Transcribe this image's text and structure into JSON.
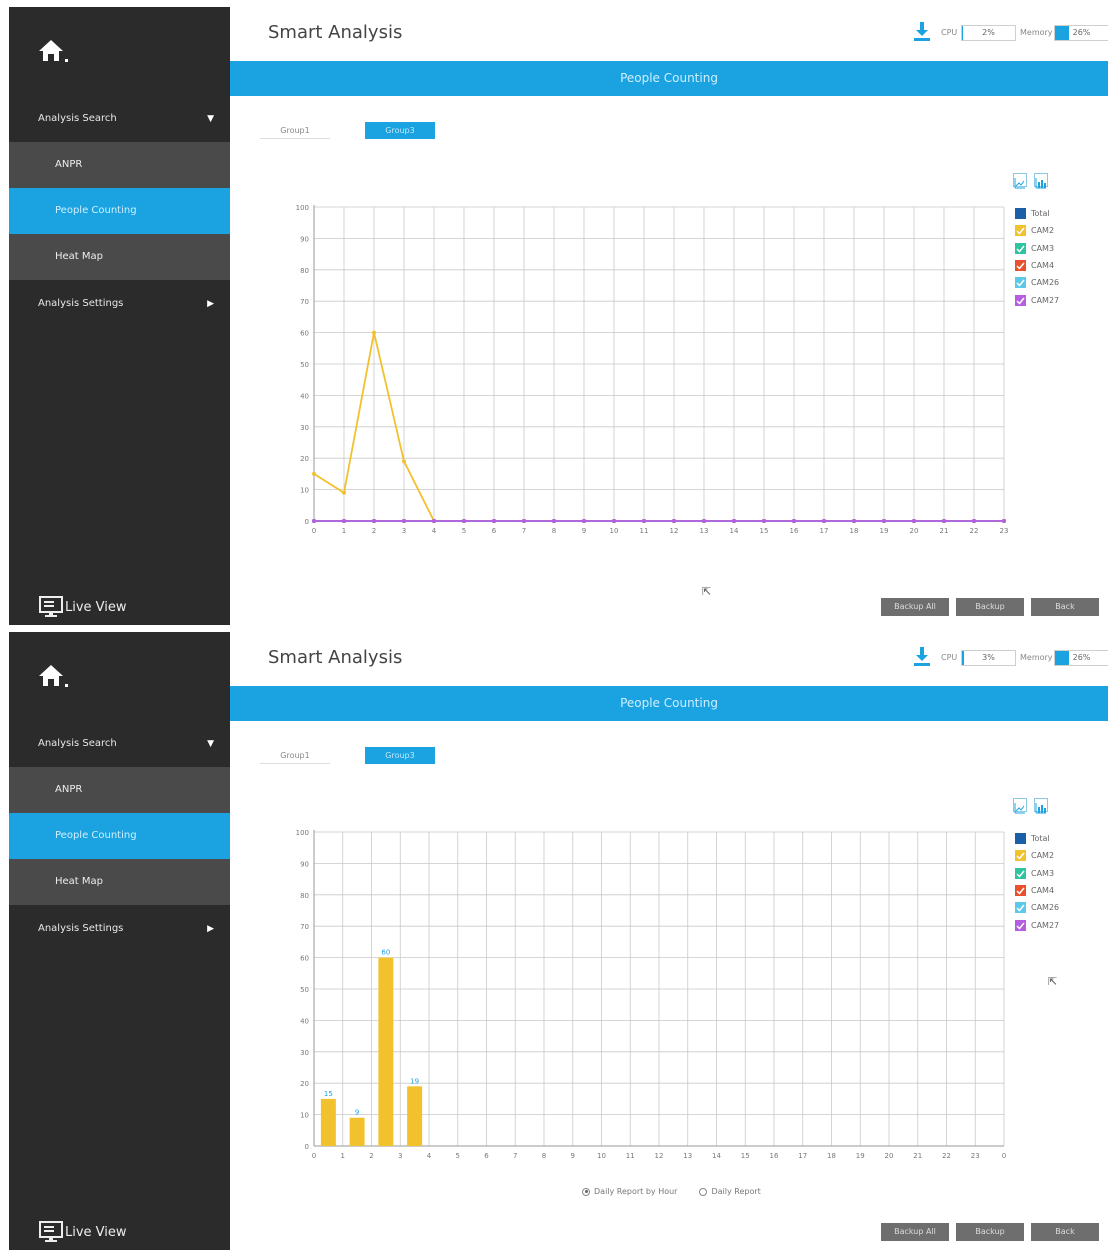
{
  "screens": [
    {
      "mode": "line",
      "cpu": "2%",
      "cpu_pct": 2,
      "memory": "26%",
      "memory_pct": 26
    },
    {
      "mode": "bar",
      "cpu": "3%",
      "cpu_pct": 3,
      "memory": "26%",
      "memory_pct": 26
    }
  ],
  "app": {
    "title": "Smart Analysis",
    "banner": "People Counting",
    "cpu_label": "CPU",
    "memory_label": "Memory"
  },
  "sidebar": {
    "group1": "Analysis Search",
    "items": [
      "ANPR",
      "People Counting",
      "Heat Map"
    ],
    "active_item": "People Counting",
    "group2": "Analysis Settings",
    "live_view": "Live View"
  },
  "tabs": [
    "Group1",
    "Group3"
  ],
  "active_tab": "Group3",
  "buttons": {
    "backup_all": "Backup All",
    "backup": "Backup",
    "back": "Back"
  },
  "report": {
    "by_hour": "Daily Report by Hour",
    "daily": "Daily Report",
    "selected": "Daily Report by Hour"
  },
  "colors": {
    "accent": "#1ba3e1",
    "sidebar": "#2b2b2b"
  },
  "chart_data": [
    {
      "type": "line",
      "categories": [
        "0",
        "1",
        "2",
        "3",
        "4",
        "5",
        "6",
        "7",
        "8",
        "9",
        "10",
        "11",
        "12",
        "13",
        "14",
        "15",
        "16",
        "17",
        "18",
        "19",
        "20",
        "21",
        "22",
        "23"
      ],
      "ylim": [
        0,
        100
      ],
      "yticks": [
        0,
        10,
        20,
        30,
        40,
        50,
        60,
        70,
        80,
        90,
        100
      ],
      "series": [
        {
          "name": "Total",
          "color": "#1a5fa8",
          "values": [
            0,
            0,
            0,
            0,
            0,
            0,
            0,
            0,
            0,
            0,
            0,
            0,
            0,
            0,
            0,
            0,
            0,
            0,
            0,
            0,
            0,
            0,
            0,
            0
          ]
        },
        {
          "name": "CAM2",
          "color": "#f2c12e",
          "values": [
            15,
            9,
            60,
            19,
            0,
            0,
            0,
            0,
            0,
            0,
            0,
            0,
            0,
            0,
            0,
            0,
            0,
            0,
            0,
            0,
            0,
            0,
            0,
            0
          ]
        },
        {
          "name": "CAM3",
          "color": "#2ec4a0",
          "values": [
            0,
            0,
            0,
            0,
            0,
            0,
            0,
            0,
            0,
            0,
            0,
            0,
            0,
            0,
            0,
            0,
            0,
            0,
            0,
            0,
            0,
            0,
            0,
            0
          ]
        },
        {
          "name": "CAM4",
          "color": "#e8502e",
          "values": [
            0,
            0,
            0,
            0,
            0,
            0,
            0,
            0,
            0,
            0,
            0,
            0,
            0,
            0,
            0,
            0,
            0,
            0,
            0,
            0,
            0,
            0,
            0,
            0
          ]
        },
        {
          "name": "CAM26",
          "color": "#5ec8e8",
          "values": [
            0,
            0,
            0,
            0,
            0,
            0,
            0,
            0,
            0,
            0,
            0,
            0,
            0,
            0,
            0,
            0,
            0,
            0,
            0,
            0,
            0,
            0,
            0,
            0
          ]
        },
        {
          "name": "CAM27",
          "color": "#b65ee0",
          "values": [
            0,
            0,
            0,
            0,
            0,
            0,
            0,
            0,
            0,
            0,
            0,
            0,
            0,
            0,
            0,
            0,
            0,
            0,
            0,
            0,
            0,
            0,
            0,
            0
          ]
        }
      ]
    },
    {
      "type": "bar",
      "categories": [
        "0",
        "1",
        "2",
        "3",
        "4",
        "5",
        "6",
        "7",
        "8",
        "9",
        "10",
        "11",
        "12",
        "13",
        "14",
        "15",
        "16",
        "17",
        "18",
        "19",
        "20",
        "21",
        "22",
        "23",
        "0"
      ],
      "ylim": [
        0,
        100
      ],
      "yticks": [
        0,
        10,
        20,
        30,
        40,
        50,
        60,
        70,
        80,
        90,
        100
      ],
      "series": [
        {
          "name": "CAM2",
          "color": "#f2c12e",
          "values": [
            15,
            9,
            60,
            19
          ]
        }
      ],
      "data_labels": [
        "15",
        "9",
        "60",
        "19"
      ]
    }
  ]
}
